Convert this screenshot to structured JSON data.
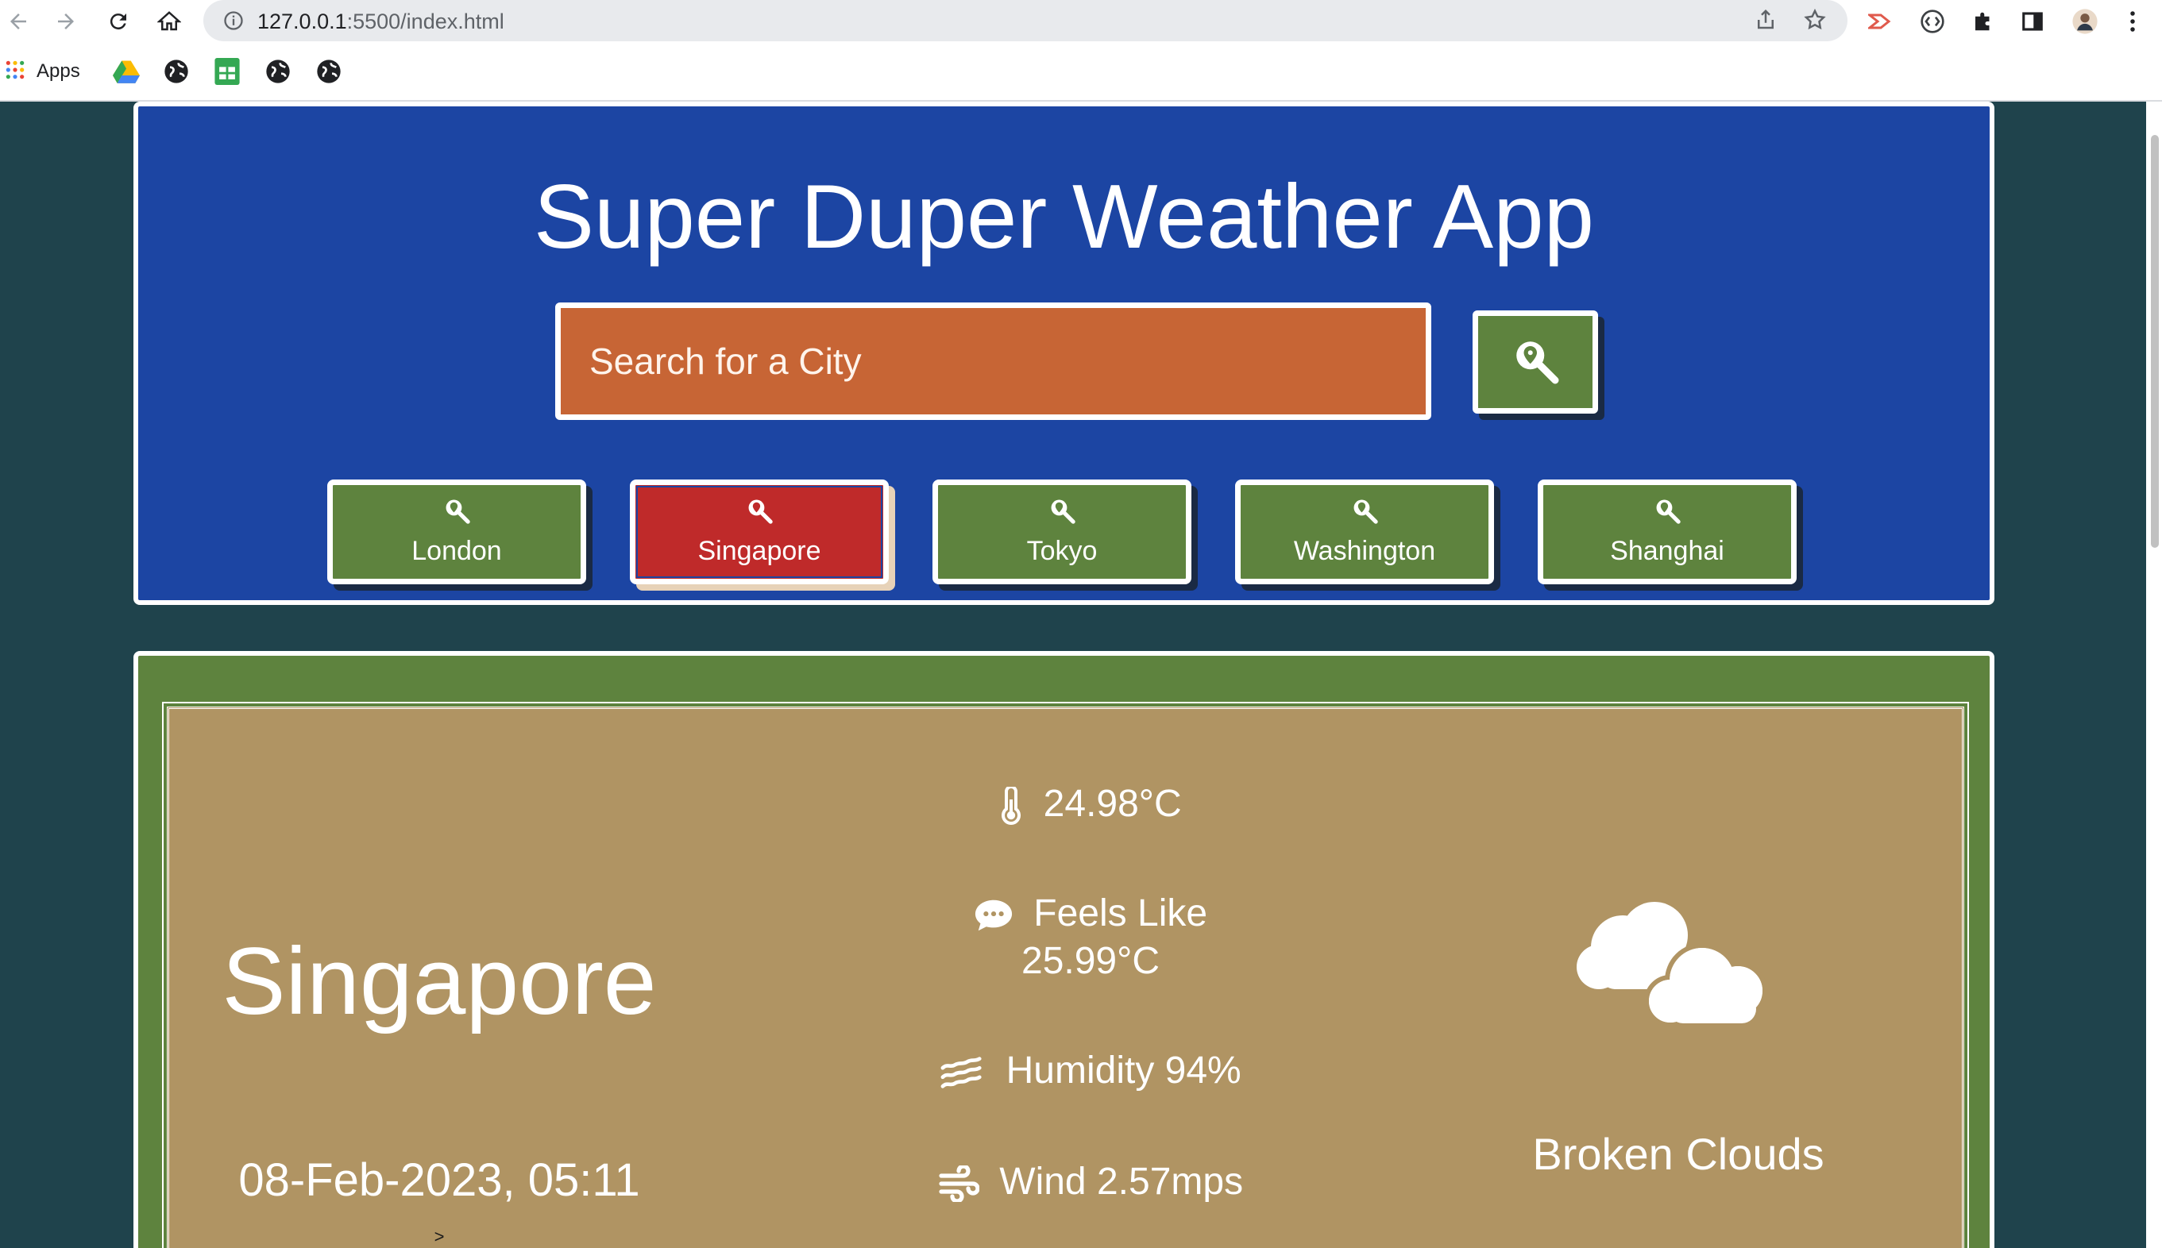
{
  "browser": {
    "url_host": "127.0.0.1",
    "url_path": ":5500/index.html",
    "bookmarks": {
      "apps_label": "Apps"
    }
  },
  "app": {
    "title": "Super Duper Weather App",
    "search": {
      "placeholder": "Search for a City",
      "value": ""
    },
    "quick_cities": [
      {
        "label": "London",
        "active": false
      },
      {
        "label": "Singapore",
        "active": true
      },
      {
        "label": "Tokyo",
        "active": false
      },
      {
        "label": "Washington",
        "active": false
      },
      {
        "label": "Shanghai",
        "active": false
      }
    ]
  },
  "weather": {
    "city": "Singapore",
    "datetime": "08-Feb-2023, 05:11",
    "footnote": ">",
    "temperature": "24.98°C",
    "feels_like_label": "Feels Like",
    "feels_like_value": "25.99°C",
    "humidity": "Humidity 94%",
    "wind": "Wind 2.57mps",
    "condition": "Broken Clouds",
    "condition_icon": "broken-clouds-icon"
  },
  "colors": {
    "page_bg": "#1f434c",
    "header_bg": "#1c45a3",
    "search_bg": "#c76535",
    "button_green": "#5e833e",
    "button_active_red": "#bf2a2a",
    "card_tan": "#b09463"
  }
}
